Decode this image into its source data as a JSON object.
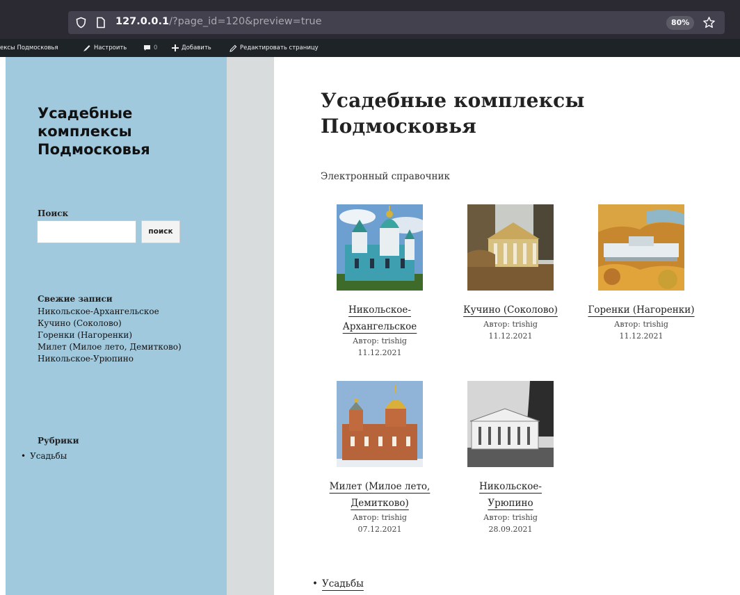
{
  "browser": {
    "url_host": "127.0.0.1",
    "url_path": "/?page_id=120&preview=true",
    "zoom": "80%"
  },
  "admin_bar": {
    "site_name": "ексы Подмосковья",
    "customize": "Настроить",
    "comments_count": "0",
    "add_new": "Добавить",
    "edit_page": "Редактировать страницу"
  },
  "sidebar": {
    "site_title": "Усадебные комплексы Подмосковья",
    "search_label": "Поиск",
    "search_button": "поиск",
    "search_value": "",
    "recent_title": "Свежие записи",
    "recent_posts": [
      "Никольское-Архангельское",
      "Кучино (Соколово)",
      "Горенки (Нагоренки)",
      "Милет (Милое лето, Демитково)",
      "Никольское-Урюпино"
    ],
    "categories_title": "Рубрики",
    "categories": [
      "Усадьбы"
    ]
  },
  "main": {
    "title": "Усадебные комплексы Подмосковья",
    "subtitle": "Электронный справочник",
    "posts": [
      {
        "title": "Никольское-Архангельское",
        "author": "Автор: trishig",
        "date": "11.12.2021"
      },
      {
        "title": "Кучино (Соколово)",
        "author": "Автор: trishig",
        "date": "11.12.2021"
      },
      {
        "title": "Горенки (Нагоренки)",
        "author": "Автор: trishig",
        "date": "11.12.2021"
      },
      {
        "title": "Милет (Милое лето, Демитково)",
        "author": "Автор: trishig",
        "date": "07.12.2021"
      },
      {
        "title": "Никольское-Урюпино",
        "author": "Автор: trishig",
        "date": "28.09.2021"
      }
    ],
    "categories": [
      "Усадьбы"
    ]
  },
  "colors": {
    "sidebar_bg": "#a1c9de",
    "gutter_bg": "#d9dcdd",
    "admin_bar_bg": "#1d2327",
    "browser_chrome_bg": "#2b2a33"
  }
}
